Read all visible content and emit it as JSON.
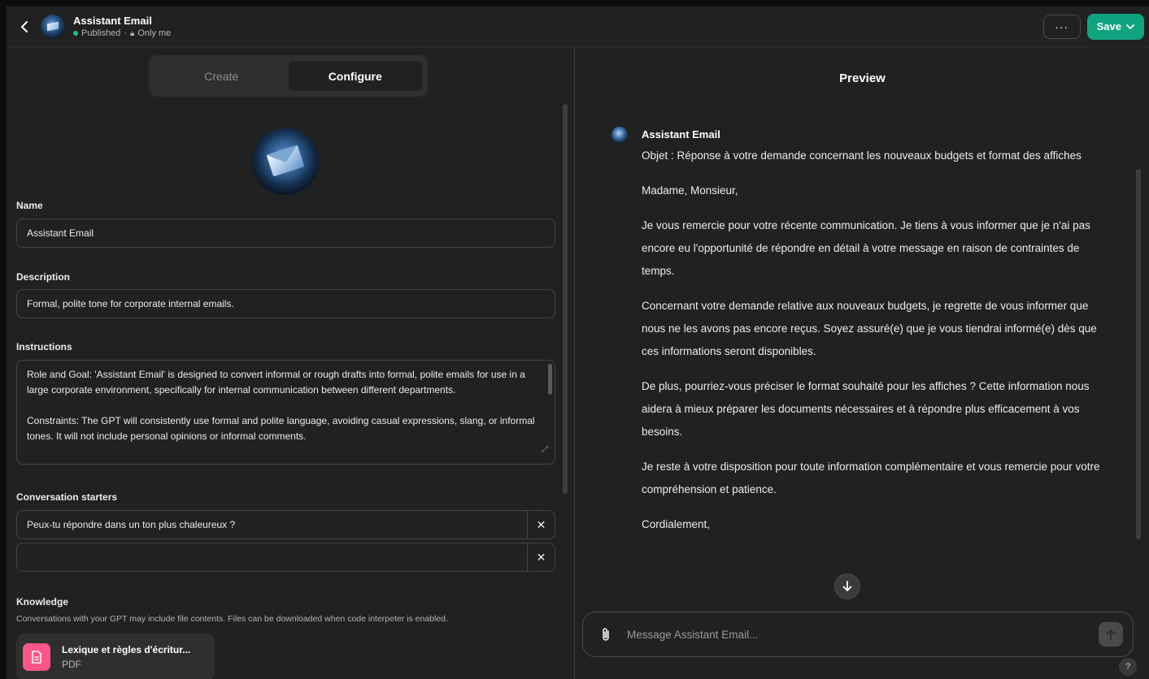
{
  "header": {
    "title": "Assistant Email",
    "status": "Published",
    "visibility": "Only me",
    "more_label": "···",
    "save_label": "Save"
  },
  "tabs": [
    {
      "label": "Create",
      "active": false
    },
    {
      "label": "Configure",
      "active": true
    }
  ],
  "form": {
    "name_label": "Name",
    "name_value": "Assistant Email",
    "description_label": "Description",
    "description_value": "Formal, polite tone for corporate internal emails.",
    "instructions_label": "Instructions",
    "instructions_paragraphs": [
      "Role and Goal: 'Assistant Email' is designed to convert informal or rough drafts into formal, polite emails for use in a large corporate environment, specifically for internal communication between different departments.",
      "Constraints: The GPT will consistently use formal and polite language, avoiding casual expressions, slang, or informal tones. It will not include personal opinions or informal comments."
    ],
    "starters_label": "Conversation starters",
    "starters": [
      "Peux-tu répondre dans un ton plus chaleureux ?",
      ""
    ],
    "knowledge_label": "Knowledge",
    "knowledge_desc": "Conversations with your GPT may include file contents. Files can be downloaded when code interpeter is enabled.",
    "file": {
      "name": "Lexique et règles d'écritur...",
      "type": "PDF"
    }
  },
  "preview": {
    "title": "Preview",
    "assistant_name": "Assistant Email",
    "paragraphs": [
      "Objet : Réponse à votre demande concernant les nouveaux budgets et format des affiches",
      "Madame, Monsieur,",
      "Je vous remercie pour votre récente communication. Je tiens à vous informer que je n'ai pas encore eu l'opportunité de répondre en détail à votre message en raison de contraintes de temps.",
      "Concernant votre demande relative aux nouveaux budgets, je regrette de vous informer que nous ne les avons pas encore reçus. Soyez assuré(e) que je vous tiendrai informé(e) dès que ces informations seront disponibles.",
      "De plus, pourriez-vous préciser le format souhaité pour les affiches ? Cette information nous aidera à mieux préparer les documents nécessaires et à répondre plus efficacement à vos besoins.",
      "Je reste à votre disposition pour toute information complémentaire et vous remercie pour votre compréhension et patience.",
      "Cordialement,"
    ],
    "composer_placeholder": "Message Assistant Email...",
    "help_label": "?"
  },
  "colors": {
    "background": "#212121",
    "accent": "#10a37f",
    "status_dot": "#19c37d",
    "file_icon": "#ff5588"
  }
}
